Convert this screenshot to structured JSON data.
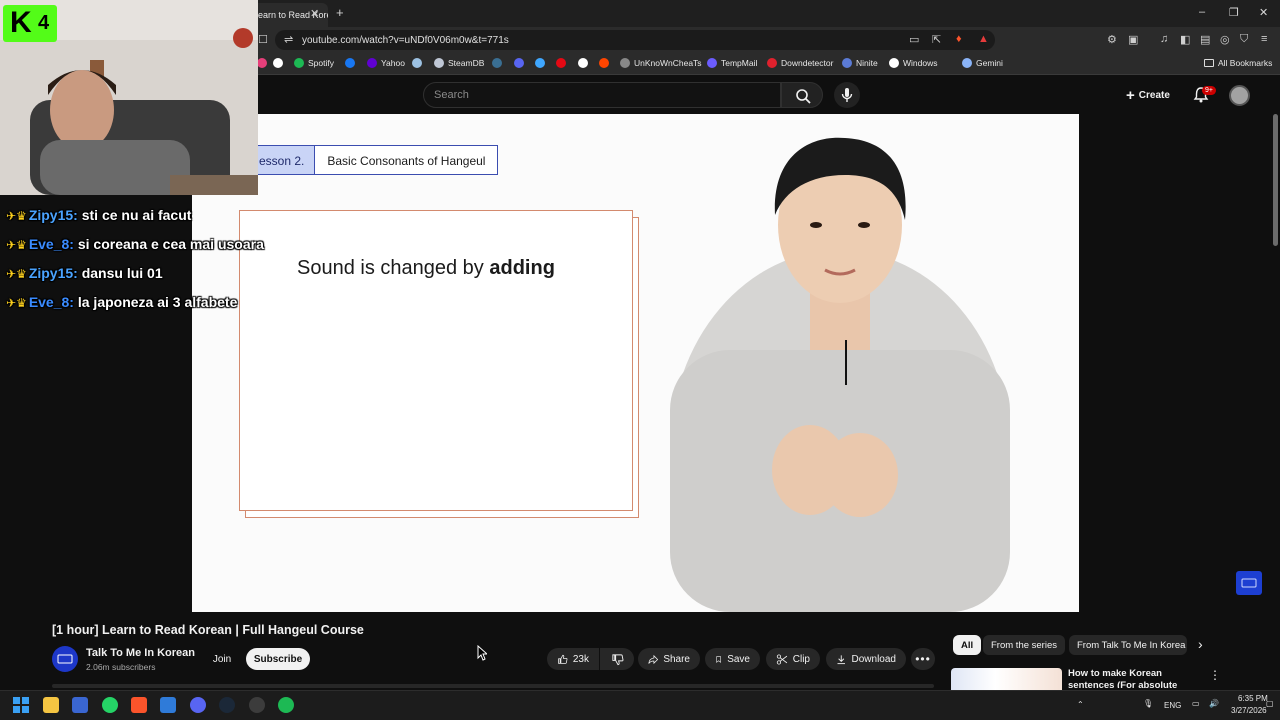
{
  "browser": {
    "tab_title": "earn to Read Korean",
    "tab_close": "✕",
    "new_tab": "+",
    "url": "youtube.com/watch?v=uNDf0V06m0w&t=771s",
    "window_controls": [
      "–",
      "❐",
      "✕"
    ],
    "bookmarks": [
      {
        "label": "",
        "color": "#e63f7a"
      },
      {
        "label": "",
        "color": "#ffffff"
      },
      {
        "label": "Spotify",
        "color": "#1db954"
      },
      {
        "label": "",
        "color": "#1877f2"
      },
      {
        "label": "Yahoo",
        "color": "#6001d2"
      },
      {
        "label": "",
        "color": "#9cc1e2"
      },
      {
        "label": "SteamDB",
        "color": "#bfc7d5"
      },
      {
        "label": "",
        "color": "#3a6f93"
      },
      {
        "label": "",
        "color": "#5865f2"
      },
      {
        "label": "",
        "color": "#3fa7ff"
      },
      {
        "label": "",
        "color": "#e50914"
      },
      {
        "label": "",
        "color": "#ffffff"
      },
      {
        "label": "",
        "color": "#ff4500"
      },
      {
        "label": "UnKnoWnCheaTs",
        "color": "#888888"
      },
      {
        "label": "TempMail",
        "color": "#6b5cff"
      },
      {
        "label": "Downdetector",
        "color": "#e0212d"
      },
      {
        "label": "Ninite",
        "color": "#5b7bd6"
      },
      {
        "label": "Windows",
        "color": "#ffffff"
      },
      {
        "label": "Gemini",
        "color": "#8ab4f8"
      }
    ],
    "all_bookmarks": "All Bookmarks"
  },
  "header": {
    "search_placeholder": "Search",
    "create_label": "Create",
    "notifications_badge": "9+"
  },
  "overlay": {
    "logo_letter": "K",
    "logo_number": "4",
    "chat": [
      {
        "user": "Zipy15:",
        "message": "sti ce nu ai facut",
        "color": "#4aa3ff"
      },
      {
        "user": "Eve_8:",
        "message": "si coreana e cea mai usoara",
        "color": "#3a8bff"
      },
      {
        "user": "Zipy15:",
        "message": "dansu lui 01",
        "color": "#4aa3ff"
      },
      {
        "user": "Eve_8:",
        "message": "la japoneza ai 3 alfabete",
        "color": "#3a8bff"
      }
    ]
  },
  "video": {
    "lesson_number": "esson 2.",
    "lesson_title": "Basic Consonants of Hangeul",
    "card_text_regular": "Sound is changed by ",
    "card_text_bold": "adding"
  },
  "below_video": {
    "title": "[1 hour] Learn to Read Korean | Full Hangeul Course",
    "channel_name": "Talk To Me In Korean",
    "subscribers": "2.06m subscribers",
    "join_label": "Join",
    "subscribe_label": "Subscribe",
    "like_count": "23k",
    "share_label": "Share",
    "save_label": "Save",
    "clip_label": "Clip",
    "download_label": "Download"
  },
  "recommendations": {
    "chips": [
      "All",
      "From the series",
      "From Talk To Me In Korea"
    ],
    "first_title": "How to make Korean sentences (For absolute beginners)"
  },
  "taskbar": {
    "language": "ENG",
    "time": "6:35 PM",
    "date": "3/27/2026"
  }
}
